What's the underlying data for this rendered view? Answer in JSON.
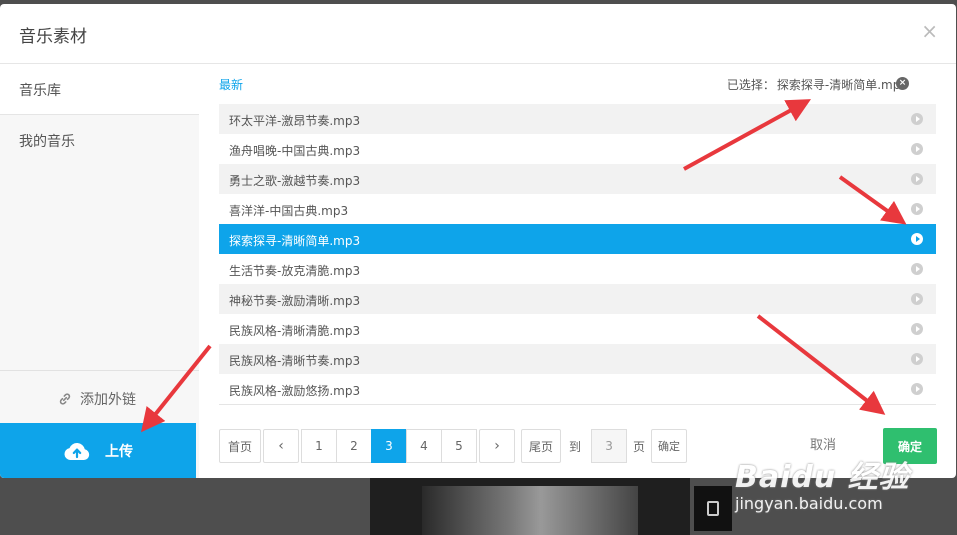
{
  "dialog": {
    "title": "音乐素材",
    "close_glyph": "×"
  },
  "sidebar": {
    "items": [
      {
        "label": "音乐库"
      },
      {
        "label": "我的音乐"
      }
    ],
    "external_link_label": "添加外链",
    "upload_label": "上传"
  },
  "main": {
    "tab_label": "最新",
    "selected_prefix": "已选择：",
    "selected_value": "探索探寻-清晰简单.mp3",
    "clear_glyph": "×",
    "tracks": [
      {
        "name": "环太平洋-激昂节奏.mp3",
        "active": false
      },
      {
        "name": "渔舟唱晚-中国古典.mp3",
        "active": false
      },
      {
        "name": "勇士之歌-激越节奏.mp3",
        "active": false
      },
      {
        "name": "喜洋洋-中国古典.mp3",
        "active": false
      },
      {
        "name": "探索探寻-清晰简单.mp3",
        "active": true
      },
      {
        "name": "生活节奏-放克清脆.mp3",
        "active": false
      },
      {
        "name": "神秘节奏-激励清晰.mp3",
        "active": false
      },
      {
        "name": "民族风格-清晰清脆.mp3",
        "active": false
      },
      {
        "name": "民族风格-清晰节奏.mp3",
        "active": false
      },
      {
        "name": "民族风格-激励悠扬.mp3",
        "active": false
      }
    ]
  },
  "pagination": {
    "first_label": "首页",
    "prev_glyph": "‹",
    "pages": [
      "1",
      "2",
      "3",
      "4",
      "5"
    ],
    "current_page": "3",
    "next_glyph": "›",
    "last_label": "尾页",
    "goto_label": "到",
    "goto_value": "3",
    "page_unit": "页",
    "goto_confirm_label": "确定"
  },
  "footer": {
    "cancel_label": "取消",
    "confirm_label": "确定"
  },
  "watermark": {
    "main": "Baidu 经验",
    "sub": "jingyan.baidu.com"
  },
  "colors": {
    "accent": "#0ea4ea",
    "confirm": "#2fbf6f",
    "annotation_arrow": "#e8383d"
  }
}
